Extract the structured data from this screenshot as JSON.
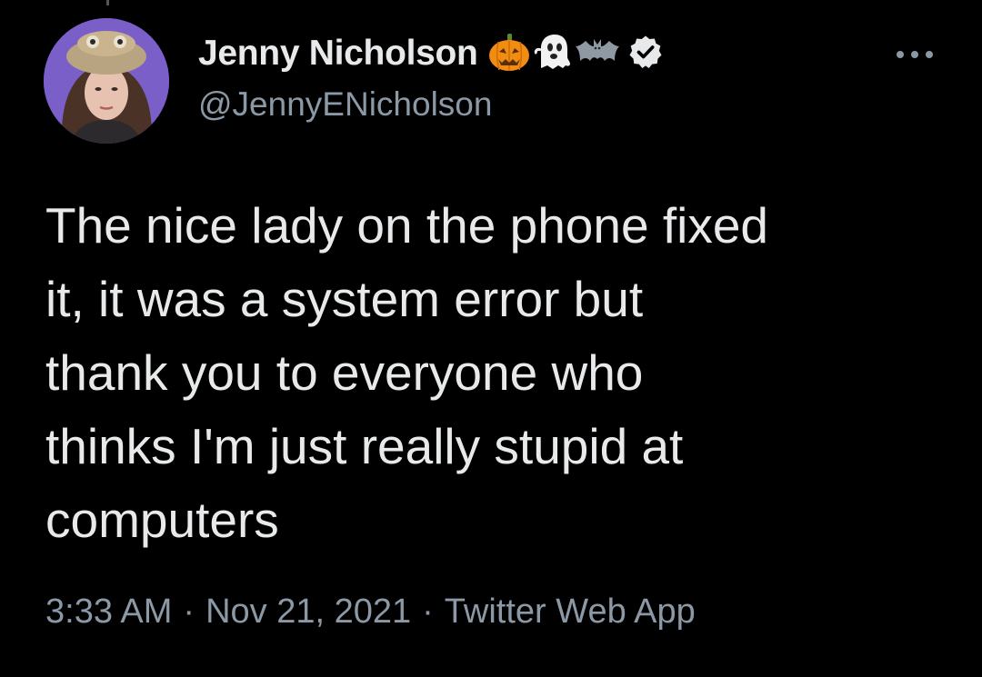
{
  "tweet": {
    "author": {
      "display_name": "Jenny Nicholson",
      "handle": "@JennyENicholson",
      "name_emojis": [
        "pumpkin-icon",
        "ghost-icon",
        "bat-icon"
      ],
      "verified": true
    },
    "text": "The nice lady on the phone fixed\nit, it was a system error but\nthank you to everyone who\nthinks I'm just really stupid at\ncomputers",
    "meta": {
      "time": "3:33 AM",
      "date": "Nov 21, 2021",
      "source": "Twitter Web App",
      "separator": "·"
    }
  },
  "colors": {
    "background": "#000000",
    "primary_text": "#e7e9ea",
    "secondary_text": "#8b98a5",
    "verified_badge": "#e7e9ea"
  }
}
